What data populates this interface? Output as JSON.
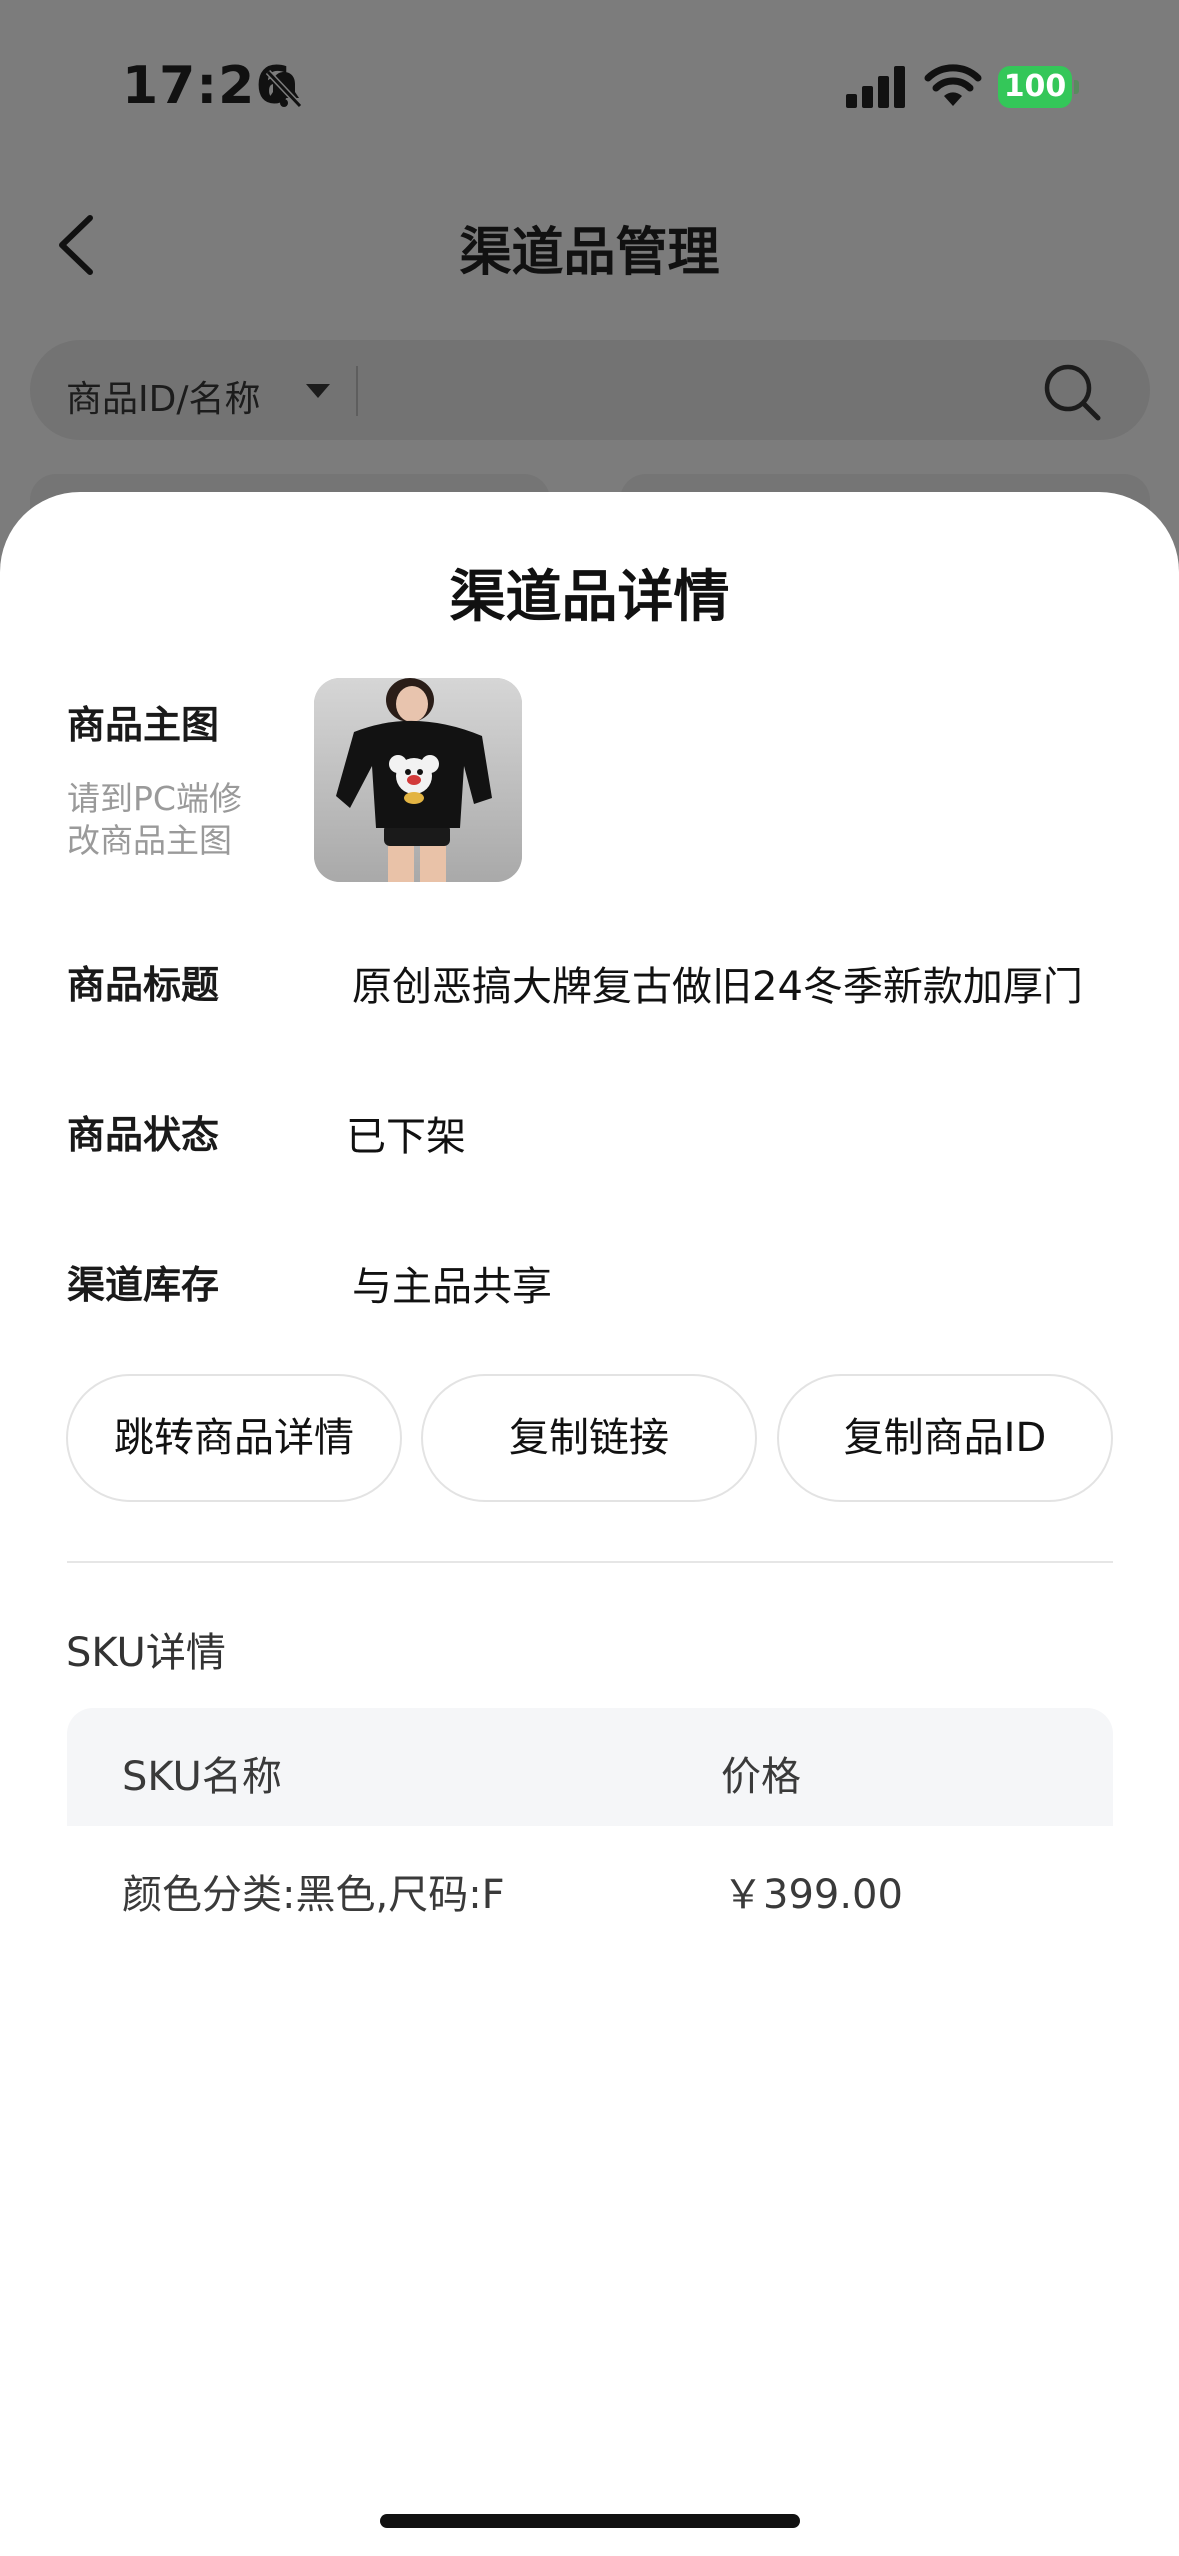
{
  "status_bar": {
    "time": "17:26",
    "battery": "100"
  },
  "nav": {
    "title": "渠道品管理"
  },
  "search": {
    "type_label": "商品ID/名称"
  },
  "sheet": {
    "title": "渠道品详情",
    "main_image_label": "商品主图",
    "main_image_hint": "请到PC端修改商品主图",
    "title_label": "商品标题",
    "title_value": "原创恶搞大牌复古做旧24冬季新款加厚门",
    "status_label": "商品状态",
    "status_value": "已下架",
    "stock_label": "渠道库存",
    "stock_value": "与主品共享",
    "buttons": {
      "goto_detail": "跳转商品详情",
      "copy_link": "复制链接",
      "copy_id": "复制商品ID"
    },
    "sku_section_title": "SKU详情",
    "sku_table": {
      "headers": [
        "SKU名称",
        "价格"
      ],
      "rows": [
        {
          "name": "颜色分类:黑色,尺码:F",
          "price": "￥399.00"
        }
      ]
    }
  },
  "colors": {
    "battery": "#34c759",
    "overlay": "#7c7c7c"
  }
}
